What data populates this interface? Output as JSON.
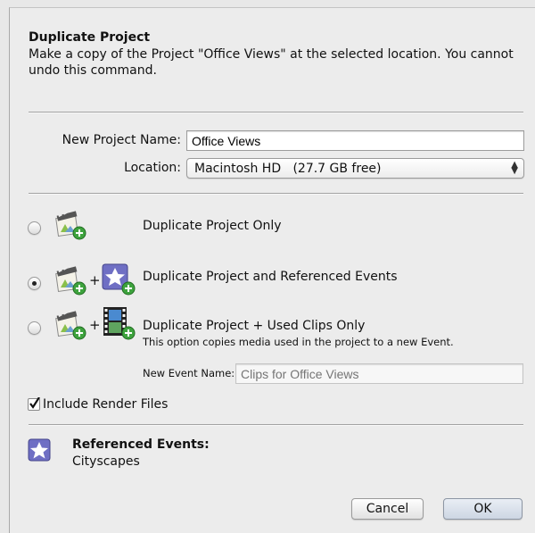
{
  "dialog": {
    "title": "Duplicate Project",
    "description": "Make a copy of the Project \"Office Views\" at the selected location. You cannot undo this command."
  },
  "form": {
    "name_label": "New Project Name:",
    "name_value": "Office Views",
    "location_label": "Location:",
    "location_value": "Macintosh HD   (27.7 GB free)"
  },
  "options": [
    {
      "label": "Duplicate Project Only",
      "selected": false
    },
    {
      "label": "Duplicate Project and Referenced Events",
      "selected": true
    },
    {
      "label": "Duplicate Project + Used Clips Only",
      "sublabel": "This option copies media used in the project to a new Event.",
      "selected": false
    }
  ],
  "plus": "+",
  "event": {
    "label": "New Event Name:",
    "placeholder": "Clips for Office Views"
  },
  "render": {
    "label": "Include Render Files",
    "checked": true
  },
  "referenced": {
    "title": "Referenced Events:",
    "value": "Cityscapes"
  },
  "buttons": {
    "cancel": "Cancel",
    "ok": "OK"
  },
  "icons": {
    "project": "clapper-project-icon",
    "event": "star-event-icon",
    "clips": "film-clip-icon",
    "add_badge": "green-plus-badge-icon"
  }
}
